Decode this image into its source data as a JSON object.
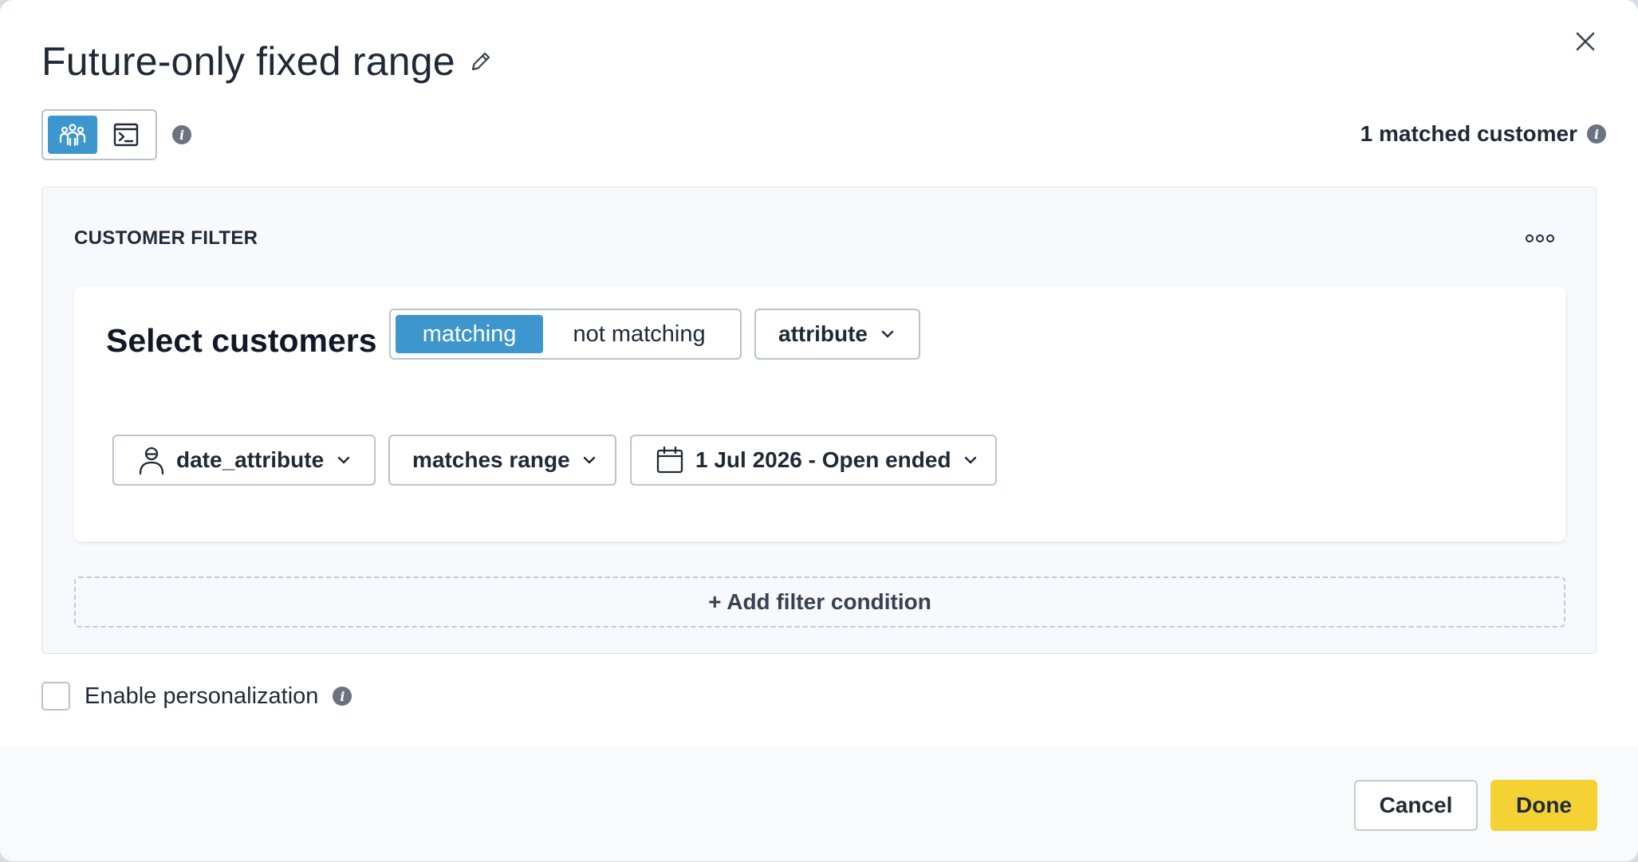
{
  "modal": {
    "title": "Future-only fixed range",
    "matched_count_label": "1 matched customer"
  },
  "icons": {
    "close": "close-icon",
    "edit": "pencil-icon",
    "audience_mode": "people-group-icon",
    "code_mode": "terminal-icon",
    "info": "info-icon",
    "more": "more-horizontal-icon",
    "person": "person-icon",
    "calendar": "calendar-icon",
    "chevron": "chevron-down-icon"
  },
  "filter": {
    "section_label": "CUSTOMER FILTER",
    "heading": "Select customers",
    "match_options": [
      "matching",
      "not matching"
    ],
    "selected_match": "matching",
    "type_select": "attribute",
    "condition": {
      "attribute": "date_attribute",
      "operator": "matches range",
      "value": "1 Jul 2026 - Open ended"
    },
    "add_condition_label": "+ Add filter condition"
  },
  "personalization": {
    "label": "Enable personalization",
    "checked": false
  },
  "footer": {
    "cancel_label": "Cancel",
    "done_label": "Done"
  },
  "colors": {
    "accent": "#3d96cd",
    "primary_button": "#f5d233",
    "border": "#b9c3ce"
  }
}
